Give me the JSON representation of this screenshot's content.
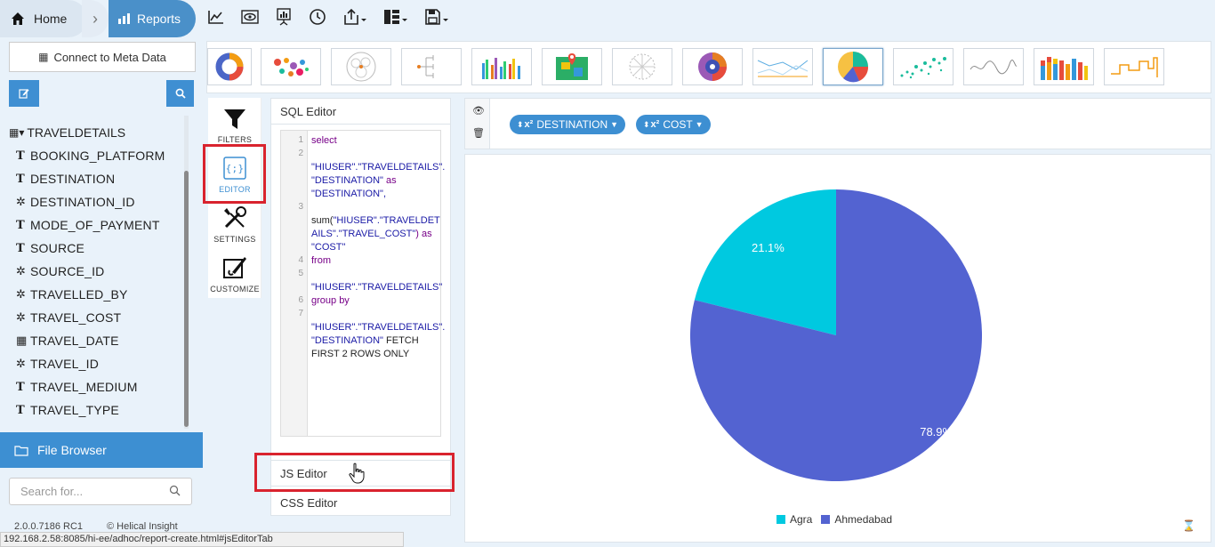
{
  "breadcrumb": {
    "home": "Home",
    "reports": "Reports"
  },
  "toolbar": {
    "icons": [
      "line-chart-icon",
      "preview-icon",
      "presentation-icon",
      "history-icon",
      "export-icon",
      "layout-icon",
      "save-icon"
    ]
  },
  "sidebar": {
    "meta_button": "Connect to Meta Data",
    "table": "TRAVELDETAILS",
    "fields": [
      {
        "type": "text",
        "name": "BOOKING_PLATFORM"
      },
      {
        "type": "text",
        "name": "DESTINATION"
      },
      {
        "type": "numeric",
        "name": "DESTINATION_ID"
      },
      {
        "type": "text",
        "name": "MODE_OF_PAYMENT"
      },
      {
        "type": "text",
        "name": "SOURCE"
      },
      {
        "type": "numeric",
        "name": "SOURCE_ID"
      },
      {
        "type": "numeric",
        "name": "TRAVELLED_BY"
      },
      {
        "type": "numeric",
        "name": "TRAVEL_COST"
      },
      {
        "type": "date",
        "name": "TRAVEL_DATE"
      },
      {
        "type": "numeric",
        "name": "TRAVEL_ID"
      },
      {
        "type": "text",
        "name": "TRAVEL_MEDIUM"
      },
      {
        "type": "text",
        "name": "TRAVEL_TYPE"
      }
    ],
    "file_browser": "File Browser",
    "search_placeholder": "Search for...",
    "version": "2.0.0.7186 RC1",
    "copyright": "© Helical Insight"
  },
  "status_url": "192.168.2.58:8085/hi-ee/adhoc/report-create.html#jsEditorTab",
  "tools": {
    "filters": "FILTERS",
    "editor": "EDITOR",
    "settings": "SETTINGS",
    "customize": "CUSTOMIZE"
  },
  "editor": {
    "sql_title": "SQL Editor",
    "js_title": "JS Editor",
    "css_title": "CSS Editor",
    "line_numbers": [
      "1",
      "2",
      "3",
      "4",
      "5",
      "6",
      "7"
    ],
    "code": {
      "l1": "select",
      "l2a": "\"HIUSER\".\"TRAVELDETAILS\".",
      "l2b": "\"DESTINATION\"",
      "l2c": " as",
      "l2d": "\"DESTINATION\",",
      "l3a": "sum(",
      "l3b": "\"HIUSER\".\"TRAVELDET",
      "l3c": "AILS\".\"TRAVEL_COST\"",
      "l3d": ") as",
      "l3e": "\"COST\"",
      "l4": "from",
      "l5": "\"HIUSER\".\"TRAVELDETAILS\"",
      "l6": "group by",
      "l7a": "\"HIUSER\".\"TRAVELDETAILS\".",
      "l7b": "\"DESTINATION\"",
      "l7c": " FETCH",
      "l7d": "FIRST 2 ROWS ONLY"
    }
  },
  "pills": {
    "destination": "DESTINATION",
    "cost": "COST",
    "prefix": "x²"
  },
  "chart_data": {
    "type": "pie",
    "categories": [
      "Agra",
      "Ahmedabad"
    ],
    "values": [
      21.1,
      78.9
    ],
    "labels": [
      "21.1%",
      "78.9%"
    ],
    "colors": [
      "#00c9e0",
      "#5363d1"
    ],
    "legend_position": "bottom-center"
  }
}
